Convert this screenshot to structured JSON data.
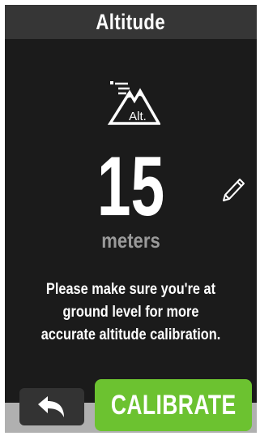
{
  "header": {
    "title": "Altitude"
  },
  "altitude": {
    "value": "15",
    "unit": "meters"
  },
  "icons": {
    "altitude": "altitude-mountain-icon",
    "edit": "pencil-edit-icon",
    "back": "back-arrow-icon",
    "altitude_badge_text": "Alt."
  },
  "message": {
    "lines": [
      "Please make sure you're at",
      "ground level for more",
      "accurate altitude calibration."
    ]
  },
  "actions": {
    "calibrate_label": "CALIBRATE"
  },
  "colors": {
    "background": "#1b1b1b",
    "title_bar": "#363636",
    "accent_green": "#6cc230",
    "unit_gray": "#9a9a9a",
    "back_button": "#333333"
  }
}
